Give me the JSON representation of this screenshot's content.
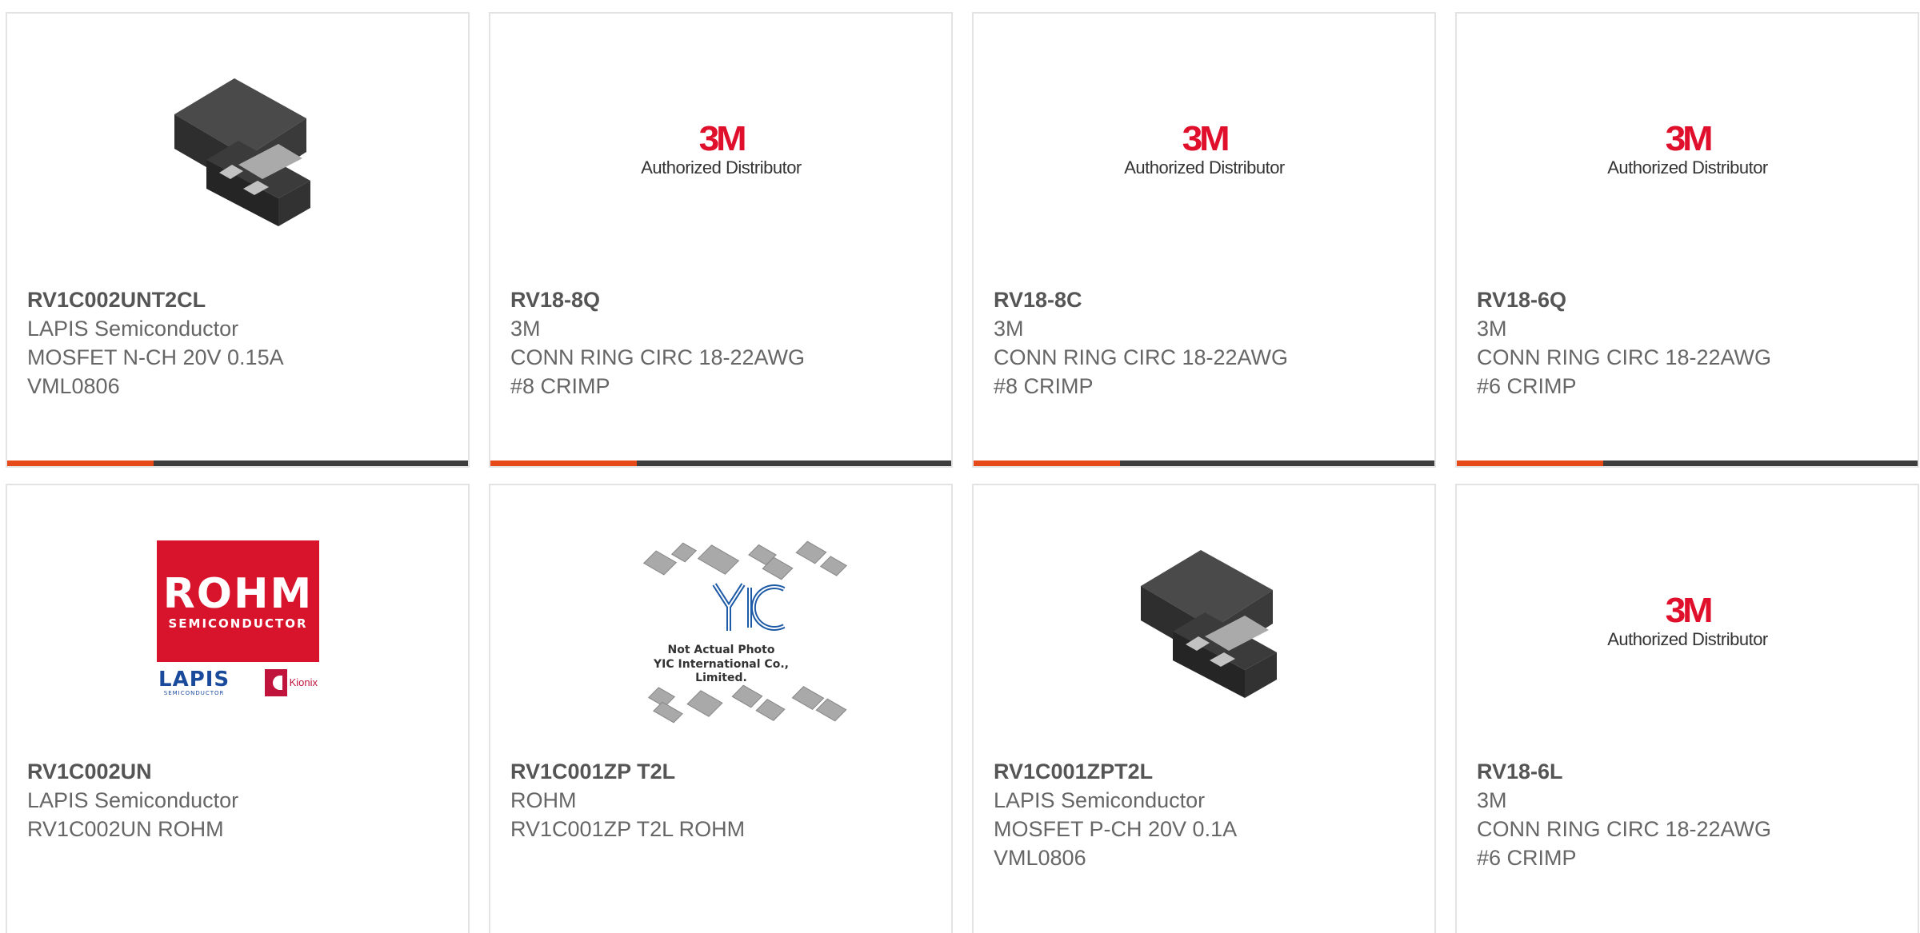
{
  "products": [
    {
      "image": "package-photo",
      "part_number": "RV1C002UNT2CL",
      "manufacturer": "LAPIS Semiconductor",
      "description_lines": [
        "MOSFET N-CH 20V 0.15A",
        "VML0806"
      ]
    },
    {
      "image": "3m-logo",
      "part_number": "RV18-8Q",
      "manufacturer": "3M",
      "description_lines": [
        "CONN RING CIRC 18-22AWG",
        "#8 CRIMP"
      ]
    },
    {
      "image": "3m-logo",
      "part_number": "RV18-8C",
      "manufacturer": "3M",
      "description_lines": [
        "CONN RING CIRC 18-22AWG",
        "#8 CRIMP"
      ]
    },
    {
      "image": "3m-logo",
      "part_number": "RV18-6Q",
      "manufacturer": "3M",
      "description_lines": [
        "CONN RING CIRC 18-22AWG",
        "#6 CRIMP"
      ]
    },
    {
      "image": "rohm-lapis-kionix-logo",
      "part_number": "RV1C002UN",
      "manufacturer": "LAPIS Semiconductor",
      "description_lines": [
        "RV1C002UN ROHM"
      ]
    },
    {
      "image": "yic-placeholder",
      "part_number": "RV1C001ZP T2L",
      "manufacturer": "ROHM",
      "description_lines": [
        "RV1C001ZP T2L ROHM"
      ]
    },
    {
      "image": "package-photo",
      "part_number": "RV1C001ZPT2L",
      "manufacturer": "LAPIS Semiconductor",
      "description_lines": [
        "MOSFET P-CH 20V 0.1A",
        "VML0806"
      ]
    },
    {
      "image": "3m-logo",
      "part_number": "RV18-6L",
      "manufacturer": "3M",
      "description_lines": [
        "CONN RING CIRC 18-22AWG",
        "#6 CRIMP"
      ]
    }
  ],
  "logos": {
    "mmm_mark": "3M",
    "mmm_sub": "Authorized Distributor",
    "rohm_big": "ROHM",
    "rohm_small": "SEMICONDUCTOR",
    "lapis": "LAPIS",
    "lapis_sub": "SEMICONDUCTOR",
    "kionix": "Kionix",
    "yic_line1": "Not Actual Photo",
    "yic_line2": "YIC International Co., Limited."
  },
  "colors": {
    "accent": "#e64a19",
    "bar": "#3e3e3e",
    "border": "#e3e3e3",
    "brand_3m": "#e0102c",
    "brand_rohm": "#d7142c"
  }
}
